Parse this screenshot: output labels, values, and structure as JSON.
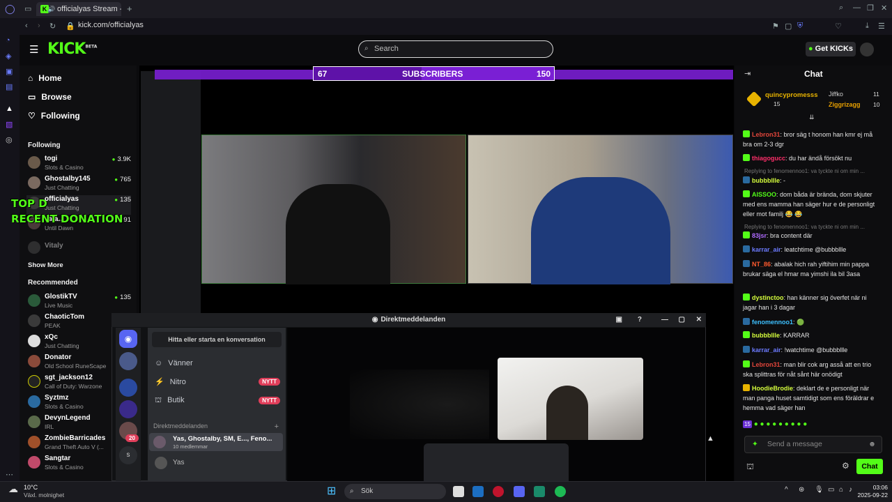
{
  "browser": {
    "tab_title": "officialyas Stream - W",
    "url": "kick.com/officialyas"
  },
  "header": {
    "logo": "KICK",
    "logo_tag": "BETA",
    "search_placeholder": "Search",
    "get_kicks": "Get KICKs"
  },
  "sidebar": {
    "nav": [
      "Home",
      "Browse",
      "Following"
    ],
    "following_title": "Following",
    "following": [
      {
        "name": "togi",
        "category": "Slots & Casino",
        "viewers": "3.9K"
      },
      {
        "name": "Ghostalby145",
        "category": "Just Chatting",
        "viewers": "765"
      },
      {
        "name": "officialyas",
        "category": "Just Chatting",
        "viewers": "135"
      },
      {
        "name": "vala...",
        "category": "Until Dawn",
        "viewers": "91"
      },
      {
        "name": "Vitaly",
        "category": "",
        "viewers": ""
      }
    ],
    "show_more": "Show More",
    "recommended_title": "Recommended",
    "recommended": [
      {
        "name": "GlostikTV",
        "category": "Live Music",
        "viewers": "135"
      },
      {
        "name": "ChaoticTom",
        "category": "PEAK",
        "viewers": ""
      },
      {
        "name": "xQc",
        "category": "Just Chatting",
        "viewers": ""
      },
      {
        "name": "Donator",
        "category": "Old School RuneScape",
        "viewers": ""
      },
      {
        "name": "sgt_jackson12",
        "category": "Call of Duty: Warzone",
        "viewers": ""
      },
      {
        "name": "Syztmz",
        "category": "Slots & Casino",
        "viewers": ""
      },
      {
        "name": "DevynLegend",
        "category": "IRL",
        "viewers": ""
      },
      {
        "name": "ZombieBarricades",
        "category": "Grand Theft Auto V (...",
        "viewers": ""
      },
      {
        "name": "Sangtar",
        "category": "Slots & Casino",
        "viewers": ""
      }
    ]
  },
  "stream": {
    "subs_current": "67",
    "subs_label": "SUBSCRIBERS",
    "subs_goal": "150",
    "subs_progress": 0.45,
    "overlay_top": "TOP D",
    "overlay_recent": "RECENT DONATION"
  },
  "discord": {
    "title": "Direktmeddelanden",
    "find_button": "Hitta eller starta en konversation",
    "items": [
      {
        "label": "Vänner",
        "badge": ""
      },
      {
        "label": "Nitro",
        "badge": "NYTT"
      },
      {
        "label": "Butik",
        "badge": "NYTT"
      }
    ],
    "dm_header": "Direktmeddelanden",
    "dms": [
      {
        "name": "Yas, Ghostalby, SM, E..., Feno...",
        "sub": "10 medlemmar"
      },
      {
        "name": "Yas",
        "sub": ""
      }
    ],
    "guild_badge": "20"
  },
  "chat": {
    "title": "Chat",
    "top_gifters": [
      {
        "name": "quincypromesss",
        "count": "15"
      },
      {
        "name": "Jiffko",
        "count": "11"
      },
      {
        "name": "Ziggrizagg",
        "count": "10"
      }
    ],
    "messages": [
      {
        "user": "Lebron31",
        "color": "#e0453a",
        "text": "bror säg t honom han kmr ej må bra om 2-3 dgr",
        "reply": ""
      },
      {
        "user": "thiagogucc",
        "color": "#ff2e6a",
        "text": "du har ändå försökt nu",
        "reply": ""
      },
      {
        "user": "bubbbllle",
        "color": "#d7ff3d",
        "text": "-",
        "reply": "Replying to fenomennoo1: va tyckte ni om min ..."
      },
      {
        "user": "AISSOO",
        "color": "#53fc18",
        "text": "dom båda är brända, dom skjuter med ens mamma han säger hur e de personligt eller mot familj 😂 😂",
        "reply": ""
      },
      {
        "user": "83jsr",
        "color": "#b06bff",
        "text": "bra content där",
        "reply": "Replying to fenomennoo1: va tyckte ni om min ..."
      },
      {
        "user": "karrar_air",
        "color": "#6c7bff",
        "text": "leatchtime @bubbbllle",
        "reply": ""
      },
      {
        "user": "NT_86",
        "color": "#ff5a2e",
        "text": "abalak hich rah yiftihim min pappa brukar säga el hmar ma yimshi ila bil 3asa",
        "reply": ""
      },
      {
        "user": "dystinctoo",
        "color": "#d7ff3d",
        "text": "han känner sig överfet när ni jagar han i 3 dagar",
        "reply": ""
      },
      {
        "user": "fenomennoo1",
        "color": "#3dc0ff",
        "text": "🟢",
        "reply": ""
      },
      {
        "user": "bubbbllle",
        "color": "#d7ff3d",
        "text": "KARRAR",
        "reply": ""
      },
      {
        "user": "karrar_air",
        "color": "#6c7bff",
        "text": "!watchtime @bubbbllle",
        "reply": ""
      },
      {
        "user": "Lebron31",
        "color": "#e0453a",
        "text": "man blir cok arg asså att en trio ska splittras för nåt sånt här onödigt",
        "reply": ""
      },
      {
        "user": "HoodieBrodie",
        "color": "#d7ff3d",
        "text": "deklart de e personligt när man panga huset samtidigt som ens föräldrar e hemma vad säger han",
        "reply": ""
      }
    ],
    "input_placeholder": "Send a message",
    "chat_button": "Chat",
    "emote_count": "15"
  },
  "taskbar": {
    "weather_temp": "10°C",
    "weather_desc": "Växl. molnighet",
    "search": "Sök",
    "time": "03:06",
    "date": "2025-09-22"
  }
}
